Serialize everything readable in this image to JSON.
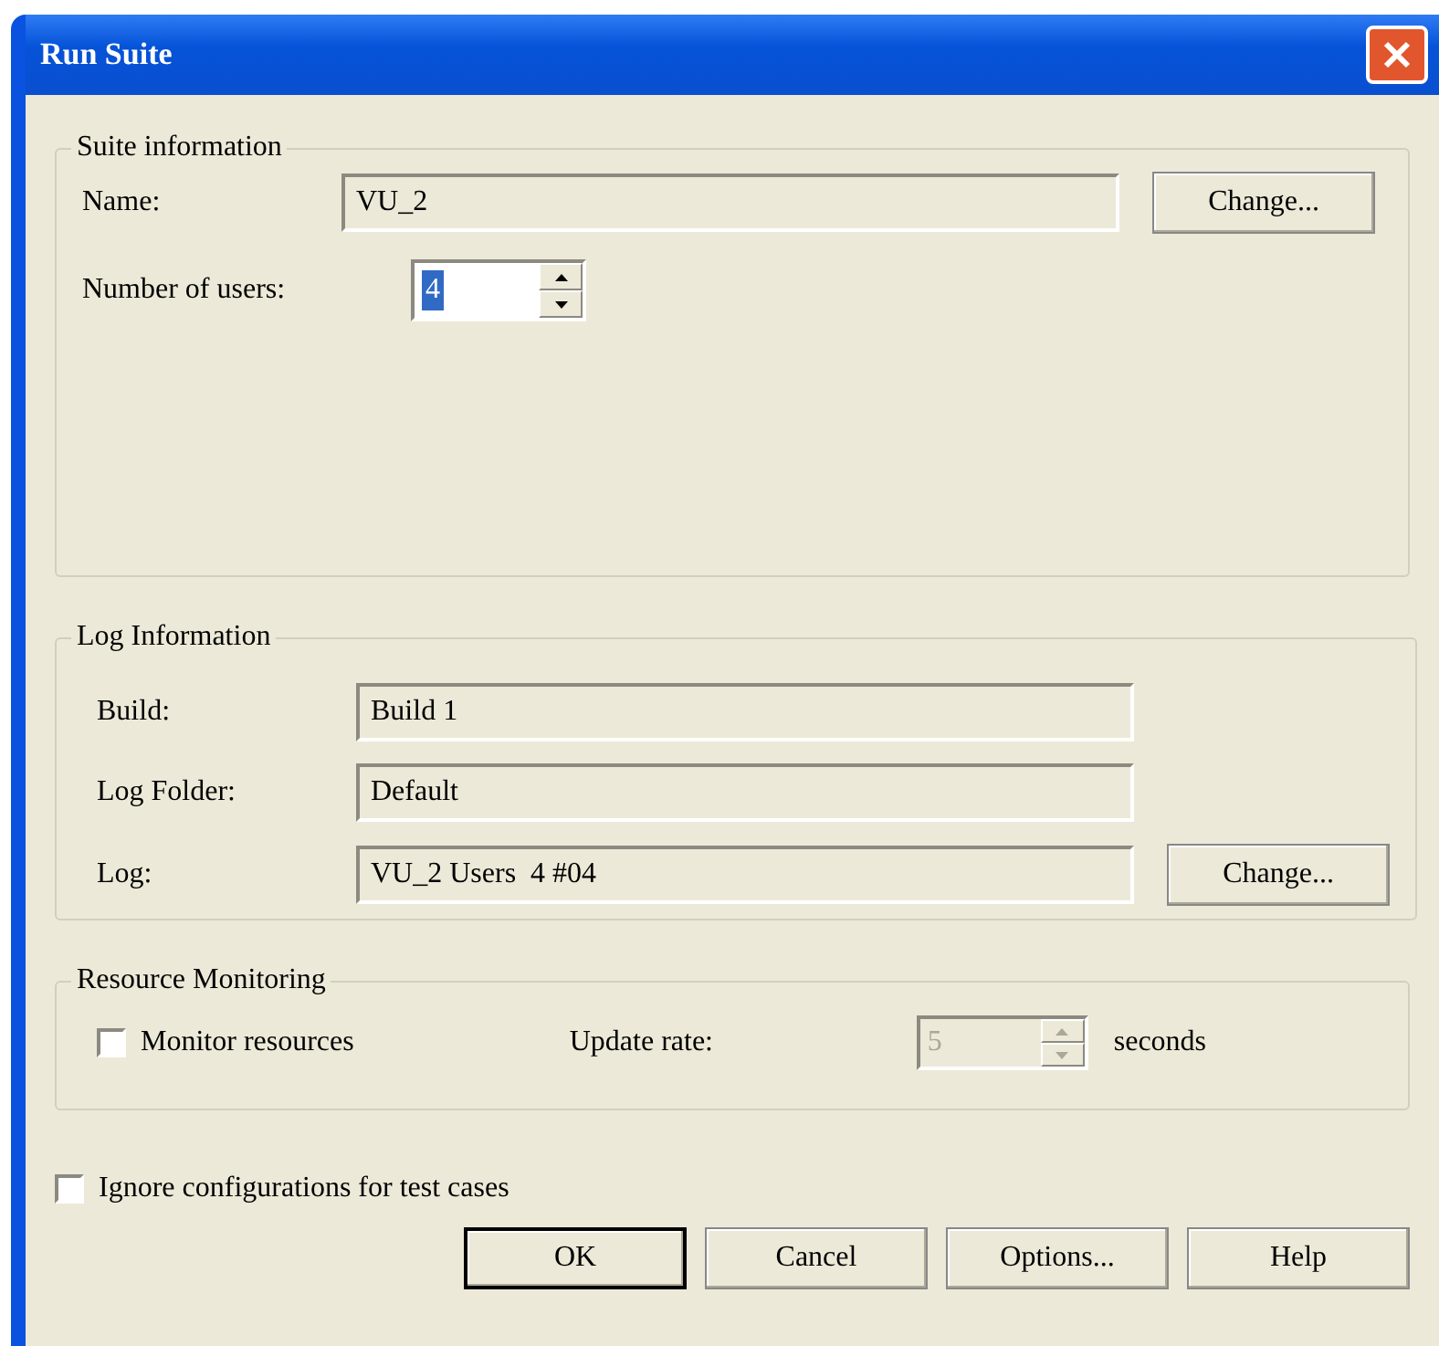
{
  "window": {
    "title": "Run Suite"
  },
  "suite_information": {
    "legend": "Suite information",
    "name_label": "Name:",
    "name_value": "VU_2",
    "change_button": "Change...",
    "users_label": "Number of users:",
    "users_value": "4",
    "users_selected": true
  },
  "log_information": {
    "legend": "Log Information",
    "fields": [
      {
        "label": "Build:",
        "value": "Build 1"
      },
      {
        "label": "Log Folder:",
        "value": "Default"
      },
      {
        "label": "Log:",
        "value": "VU_2 Users  4 #04"
      }
    ],
    "change_button": "Change..."
  },
  "resource_monitoring": {
    "legend": "Resource Monitoring",
    "monitor_label": "Monitor resources",
    "monitor_checked": false,
    "rate_label": "Update rate:",
    "rate_value": "5",
    "rate_disabled": true,
    "rate_unit": "seconds"
  },
  "ignore_configurations": {
    "label": "Ignore configurations for test cases",
    "checked": false
  },
  "buttons": [
    {
      "label": "OK",
      "default": true
    },
    {
      "label": "Cancel",
      "default": false
    },
    {
      "label": "Options...",
      "default": false
    },
    {
      "label": "Help",
      "default": false
    }
  ]
}
